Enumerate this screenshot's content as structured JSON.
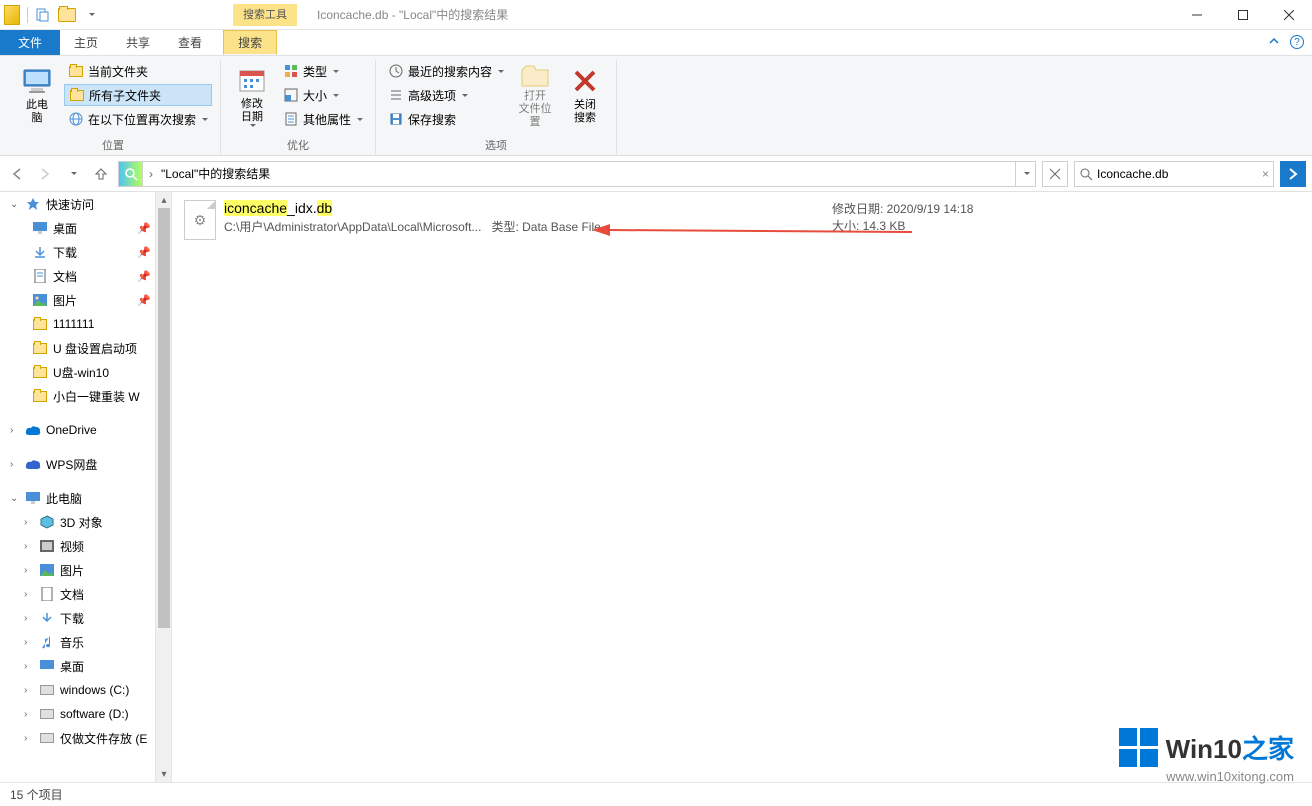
{
  "window": {
    "tool_context": "搜索工具",
    "title": "Iconcache.db - \"Local\"中的搜索结果"
  },
  "tabs": {
    "file": "文件",
    "home": "主页",
    "share": "共享",
    "view": "查看",
    "search": "搜索"
  },
  "ribbon": {
    "this_pc": "此电\n脑",
    "current_folder": "当前文件夹",
    "all_subfolders": "所有子文件夹",
    "search_again": "在以下位置再次搜索",
    "group_location": "位置",
    "modify_date": "修改\n日期",
    "type": "类型",
    "size": "大小",
    "other_props": "其他属性",
    "group_optimize": "优化",
    "recent_searches": "最近的搜索内容",
    "advanced_options": "高级选项",
    "save_search": "保存搜索",
    "open_location": "打开\n文件位置",
    "close_search": "关闭\n搜索",
    "group_options": "选项"
  },
  "address": {
    "path": "\"Local\"中的搜索结果",
    "search_value": "Iconcache.db"
  },
  "sidebar": {
    "quick_access": "快速访问",
    "desktop": "桌面",
    "downloads": "下载",
    "documents": "文档",
    "pictures": "图片",
    "f1": "1111111",
    "f2": "U 盘设置启动项",
    "f3": "U盘-win10",
    "f4": "小白一键重装 W",
    "onedrive": "OneDrive",
    "wps": "WPS网盘",
    "this_pc": "此电脑",
    "obj3d": "3D 对象",
    "videos": "视频",
    "pictures2": "图片",
    "documents2": "文档",
    "downloads2": "下载",
    "music": "音乐",
    "desktop2": "桌面",
    "drive_c": "windows (C:)",
    "drive_d": "software (D:)",
    "drive_e": "仅做文件存放 (E"
  },
  "result": {
    "name_a": "iconcache",
    "name_b": "_idx.",
    "name_c": "db",
    "path": "C:\\用户\\Administrator\\AppData\\Local\\Microsoft...",
    "type_label": "类型: ",
    "type_value": "Data Base File",
    "date_label": "修改日期: ",
    "date_value": "2020/9/19 14:18",
    "size_label": "大小: ",
    "size_value": "14.3 KB"
  },
  "status": {
    "items": "15 个项目"
  },
  "watermark": {
    "brand_a": "Win10",
    "brand_b": "之家",
    "url": "www.win10xitong.com"
  }
}
